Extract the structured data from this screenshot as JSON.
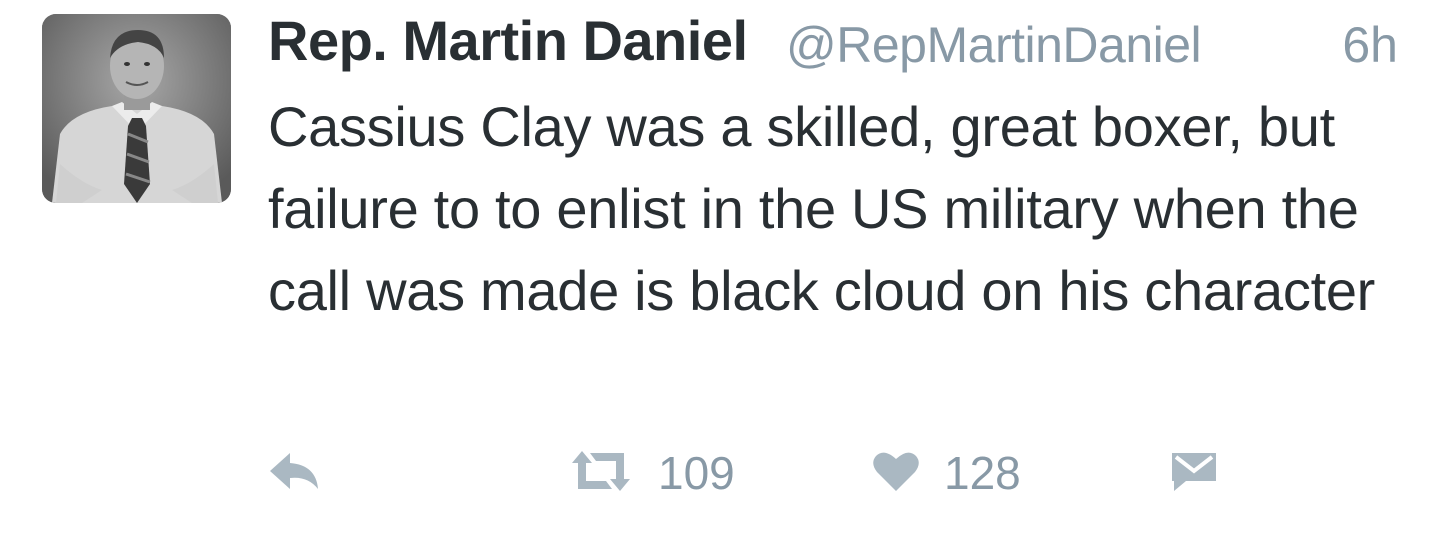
{
  "tweet": {
    "author": {
      "display_name": "Rep. Martin Daniel",
      "handle": "@RepMartinDaniel"
    },
    "timestamp": "6h",
    "text": "Cassius Clay was a skilled, great boxer, but failure to to enlist in the US military when the call was made is black cloud on his character",
    "actions": {
      "reply_icon": "reply-icon",
      "retweet_icon": "retweet-icon",
      "retweet_count": "109",
      "like_icon": "heart-icon",
      "like_count": "128",
      "dm_icon": "envelope-icon"
    }
  },
  "colors": {
    "text": "#292f33",
    "muted": "#8899a6",
    "icon": "#aab8c2",
    "background": "#ffffff"
  }
}
